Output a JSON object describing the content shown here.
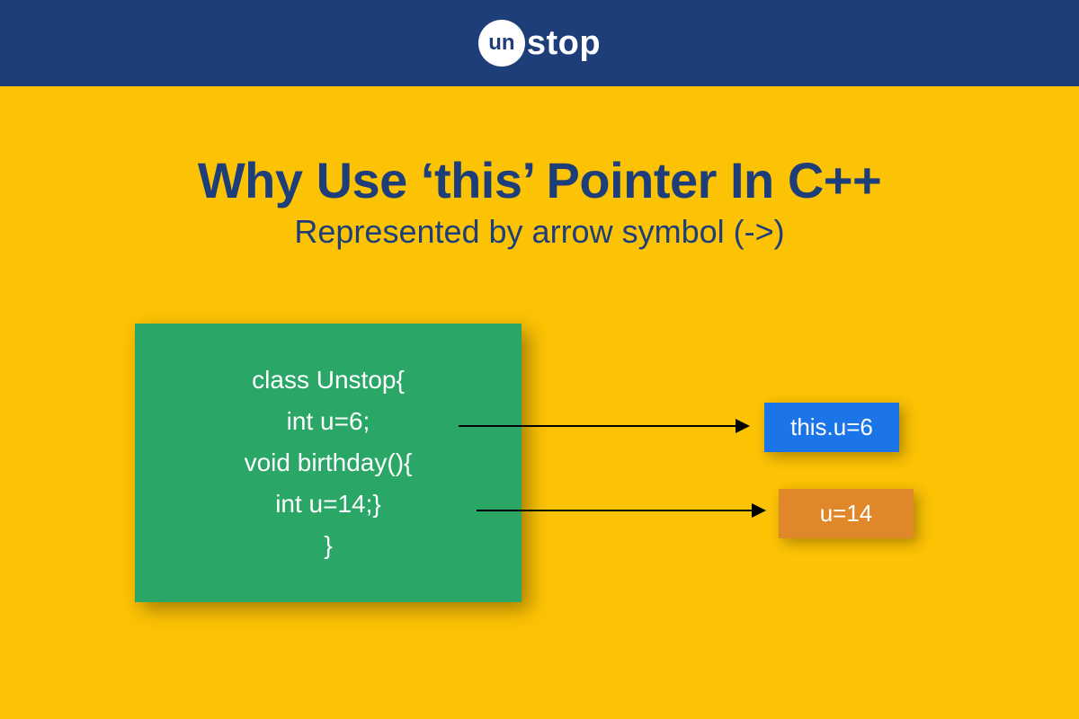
{
  "logo": {
    "circle_text": "un",
    "suffix_text": "stop"
  },
  "title": "Why Use ‘this’ Pointer In C++",
  "subtitle": "Represented by arrow symbol (->)",
  "code": {
    "line1": "class Unstop{",
    "line2": "int u=6;",
    "line3": "void birthday(){",
    "line4": "int u=14;}",
    "line5": "}"
  },
  "results": {
    "blue": "this.u=6",
    "orange": "u=14"
  }
}
